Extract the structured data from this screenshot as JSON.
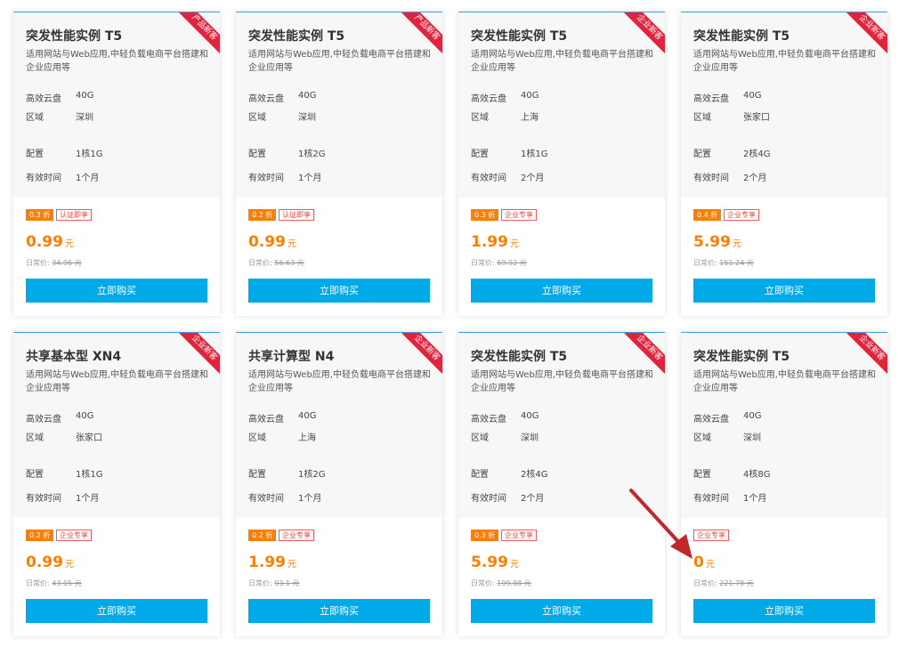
{
  "desc_text": "适用网站与Web应用,中轻负载电商平台搭建和企业应用等",
  "labels": {
    "disk": "高效云盘",
    "region": "区域",
    "config": "配置",
    "duration": "有效时间",
    "orig_prefix": "日常价:",
    "unit": "元",
    "buy": "立即购买"
  },
  "cards": [
    {
      "ribbon": "产品新客",
      "title": "突发性能实例 T5",
      "disk": "40G",
      "region": "深圳",
      "config": "1核1G",
      "duration": "1个月",
      "discount": "0.3 折",
      "tag": "认证即享",
      "price": "0.99",
      "orig": "34.96 元"
    },
    {
      "ribbon": "产品新客",
      "title": "突发性能实例 T5",
      "disk": "40G",
      "region": "深圳",
      "config": "1核2G",
      "duration": "1个月",
      "discount": "0.2 折",
      "tag": "认证即享",
      "price": "0.99",
      "orig": "56.63 元"
    },
    {
      "ribbon": "企业新客",
      "title": "突发性能实例 T5",
      "disk": "40G",
      "region": "上海",
      "config": "1核1G",
      "duration": "2个月",
      "discount": "0.3 折",
      "tag": "企业专享",
      "price": "1.99",
      "orig": "69.92 元"
    },
    {
      "ribbon": "企业新客",
      "title": "突发性能实例 T5",
      "disk": "40G",
      "region": "张家口",
      "config": "2核4G",
      "duration": "2个月",
      "discount": "0.4 折",
      "tag": "企业专享",
      "price": "5.99",
      "orig": "151.24 元"
    },
    {
      "ribbon": "企业新客",
      "title": "共享基本型 XN4",
      "disk": "40G",
      "region": "张家口",
      "config": "1核1G",
      "duration": "1个月",
      "discount": "0.2 折",
      "tag": "企业专享",
      "price": "0.99",
      "orig": "43.05 元"
    },
    {
      "ribbon": "企业新客",
      "title": "共享计算型 N4",
      "disk": "40G",
      "region": "上海",
      "config": "1核2G",
      "duration": "1个月",
      "discount": "0.2 折",
      "tag": "企业专享",
      "price": "1.99",
      "orig": "93.1 元"
    },
    {
      "ribbon": "企业新客",
      "title": "突发性能实例 T5",
      "disk": "40G",
      "region": "深圳",
      "config": "2核4G",
      "duration": "2个月",
      "discount": "0.3 折",
      "tag": "企业专享",
      "price": "5.99",
      "orig": "199.88 元"
    },
    {
      "ribbon": "企业新客",
      "title": "突发性能实例 T5",
      "disk": "40G",
      "region": "深圳",
      "config": "4核8G",
      "duration": "1个月",
      "discount": "",
      "tag": "企业专享",
      "price": "0",
      "orig": "221.78 元"
    }
  ],
  "colors": {
    "accent": "#00a9e8",
    "price": "#ff7e00",
    "ribbon": "#e2233c",
    "annotation_arrow": "#c0272d"
  },
  "annotation": {
    "icon": "red-arrow-icon"
  }
}
